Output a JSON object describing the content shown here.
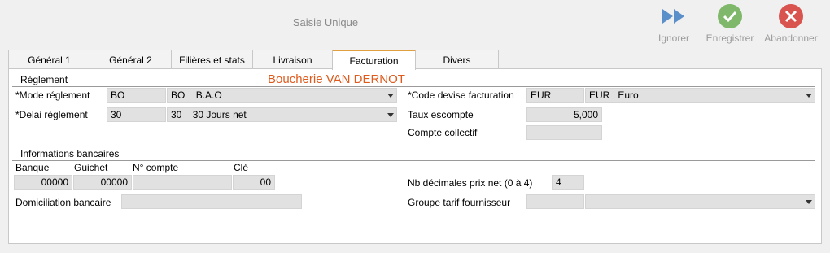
{
  "window": {
    "title": "Saisie Unique"
  },
  "toolbar": {
    "ignore_label": "Ignorer",
    "save_label": "Enregistrer",
    "cancel_label": "Abandonner"
  },
  "tabs": [
    "Général 1",
    "Général 2",
    "Filières et stats",
    "Livraison",
    "Facturation",
    "Divers"
  ],
  "active_tab": "Facturation",
  "company_name": "Boucherie VAN DERNOT",
  "reglement": {
    "section_title": "Réglement",
    "mode_label": "*Mode réglement",
    "mode_code": "BO",
    "mode_select_code": "BO",
    "mode_select_text": "B.A.O",
    "delai_label": "*Delai réglement",
    "delai_code": "30",
    "delai_select_code": "30",
    "delai_select_text": "30 Jours net"
  },
  "facturation": {
    "devise_label": "*Code devise facturation",
    "devise_code": "EUR",
    "devise_select_code": "EUR",
    "devise_select_text": "Euro",
    "escompte_label": "Taux escompte",
    "escompte_value": "5,000",
    "compte_collectif_label": "Compte collectif",
    "compte_collectif_value": ""
  },
  "bank": {
    "section_title": "Informations bancaires",
    "banque_label": "Banque",
    "guichet_label": "Guichet",
    "compte_label": "N° compte",
    "cle_label": "Clé",
    "banque_value": "00000",
    "guichet_value": "00000",
    "compte_value": "",
    "cle_value": "00",
    "domiciliation_label": "Domiciliation bancaire",
    "domiciliation_value": ""
  },
  "pricing": {
    "decimales_label": "Nb décimales prix net (0 à 4)",
    "decimales_value": "4",
    "groupe_tarif_label": "Groupe tarif fournisseur",
    "groupe_tarif_code": "",
    "groupe_tarif_text": ""
  },
  "colors": {
    "accent_tab": "#e0a040",
    "company": "#e05a1c",
    "ignore_icon": "#5b8fc9",
    "save_icon": "#7fb86a",
    "cancel_icon": "#d9534f"
  }
}
